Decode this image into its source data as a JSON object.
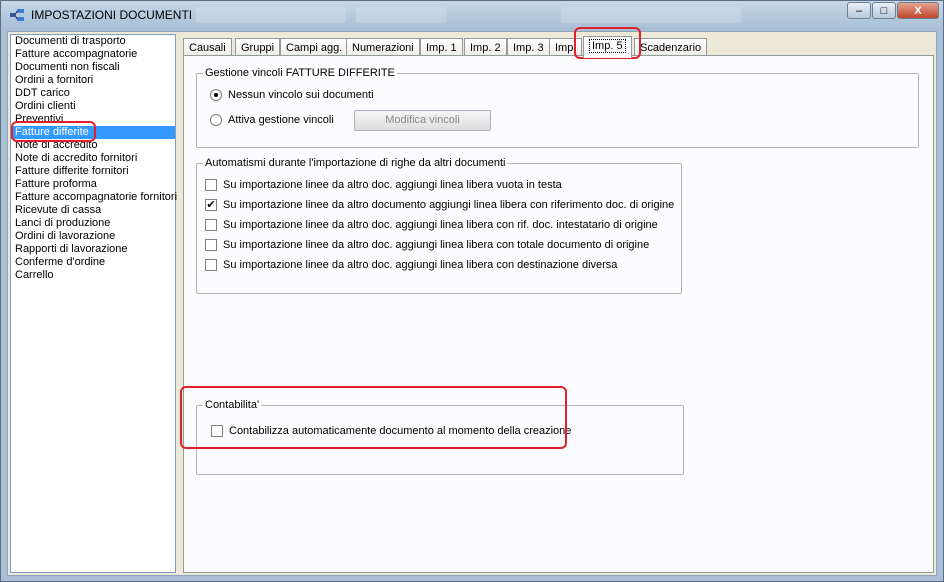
{
  "window": {
    "title": "IMPOSTAZIONI DOCUMENTI",
    "minimize_label": "–",
    "maximize_label": "□",
    "close_label": "X"
  },
  "doc_list": [
    {
      "label": "Documenti di trasporto",
      "selected": false
    },
    {
      "label": "Fatture accompagnatorie",
      "selected": false
    },
    {
      "label": "Documenti non fiscali",
      "selected": false
    },
    {
      "label": "Ordini a fornitori",
      "selected": false
    },
    {
      "label": "DDT carico",
      "selected": false
    },
    {
      "label": "Ordini clienti",
      "selected": false
    },
    {
      "label": "Preventivi",
      "selected": false
    },
    {
      "label": "Fatture differite",
      "selected": true
    },
    {
      "label": "Note di accredito",
      "selected": false
    },
    {
      "label": "Note di accredito fornitori",
      "selected": false
    },
    {
      "label": "Fatture differite fornitori",
      "selected": false
    },
    {
      "label": "Fatture proforma",
      "selected": false
    },
    {
      "label": "Fatture accompagnatorie fornitori",
      "selected": false
    },
    {
      "label": "Ricevute di cassa",
      "selected": false
    },
    {
      "label": "Lanci di produzione",
      "selected": false
    },
    {
      "label": "Ordini di lavorazione",
      "selected": false
    },
    {
      "label": "Rapporti di lavorazione",
      "selected": false
    },
    {
      "label": "Conferme d'ordine",
      "selected": false
    },
    {
      "label": "Carrello",
      "selected": false
    }
  ],
  "tabs": [
    {
      "label": "Causali",
      "active": false
    },
    {
      "label": "Gruppi",
      "active": false
    },
    {
      "label": "Campi agg.",
      "active": false
    },
    {
      "label": "Numerazioni",
      "active": false
    },
    {
      "label": "Imp. 1",
      "active": false
    },
    {
      "label": "Imp. 2",
      "active": false
    },
    {
      "label": "Imp. 3",
      "active": false
    },
    {
      "label": "Imp.",
      "active": false
    },
    {
      "label": "Imp. 5",
      "active": true
    },
    {
      "label": "Scadenzario",
      "active": false
    }
  ],
  "vincoli": {
    "title": "Gestione vincoli FATTURE DIFFERITE",
    "option_none": "Nessun vincolo sui documenti",
    "option_none_selected": true,
    "option_enable": "Attiva gestione vincoli",
    "option_enable_selected": false,
    "modify_button": "Modifica vincoli"
  },
  "automatismi": {
    "title": "Automatismi durante l'importazione di righe da altri documenti",
    "options": [
      {
        "label": "Su importazione linee da altro doc. aggiungi linea libera vuota in testa",
        "checked": false
      },
      {
        "label": "Su importazione linee da altro documento aggiungi linea libera con riferimento doc. di origine",
        "checked": true
      },
      {
        "label": "Su importazione linee da altro doc. aggiungi linea libera con rif. doc. intestatario di origine",
        "checked": false
      },
      {
        "label": "Su importazione linee da altro doc. aggiungi linea libera con totale documento di origine",
        "checked": false
      },
      {
        "label": "Su importazione linee da altro doc. aggiungi linea libera con destinazione diversa",
        "checked": false
      }
    ]
  },
  "contabilita": {
    "title": "Contabilita'",
    "option": "Contabilizza automaticamente documento al momento della creazione",
    "checked": false
  },
  "colors": {
    "selection": "#3399ff",
    "highlight": "#e0202a"
  }
}
